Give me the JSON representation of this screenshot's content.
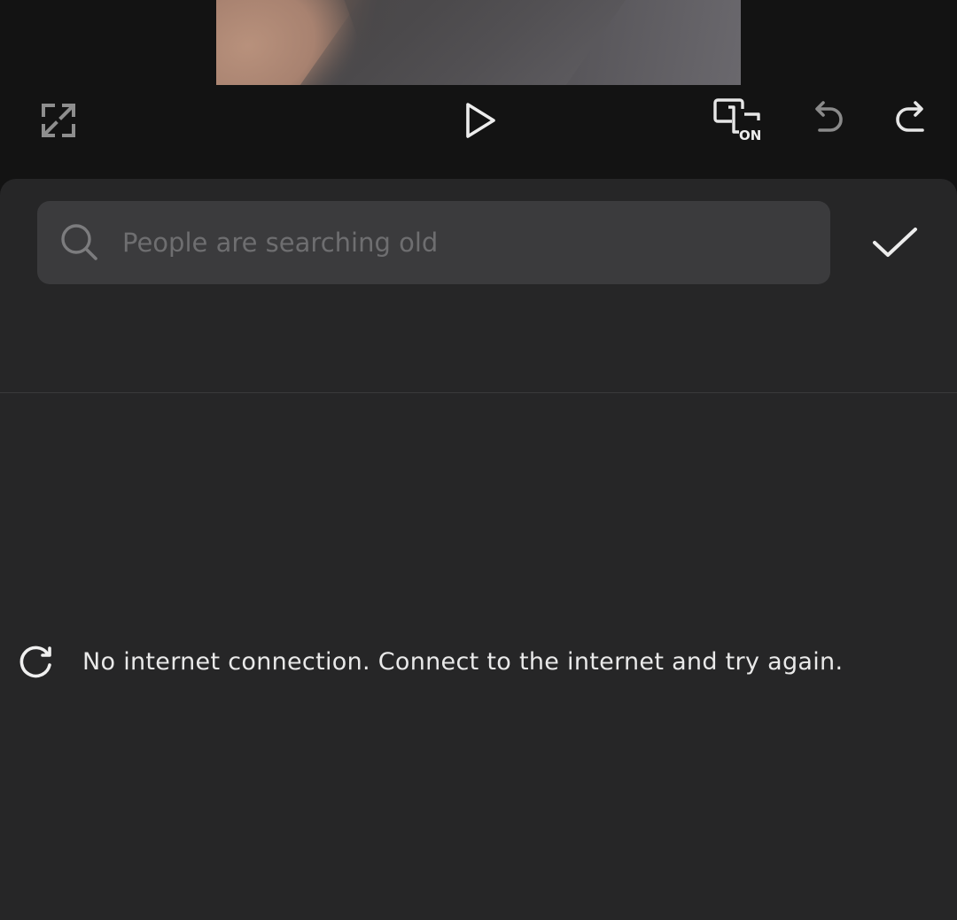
{
  "toolbar": {
    "fullscreen_icon": "fullscreen-icon",
    "play_icon": "play-icon",
    "auto_caption_icon": "auto-caption-on-icon",
    "auto_caption_badge": "ON",
    "undo_icon": "undo-icon",
    "redo_icon": "redo-icon"
  },
  "search": {
    "placeholder": "People are searching old",
    "value": "",
    "icon": "search-icon"
  },
  "confirm": {
    "icon": "checkmark-icon"
  },
  "status": {
    "message": "No internet connection. Connect to the internet and try again.",
    "retry_icon": "refresh-icon"
  },
  "colors": {
    "panel_bg": "#262627",
    "toolbar_bg": "#131313",
    "search_bg": "#3b3b3d",
    "icon": "#e6e6e6",
    "icon_dim": "#8a8a8a"
  }
}
